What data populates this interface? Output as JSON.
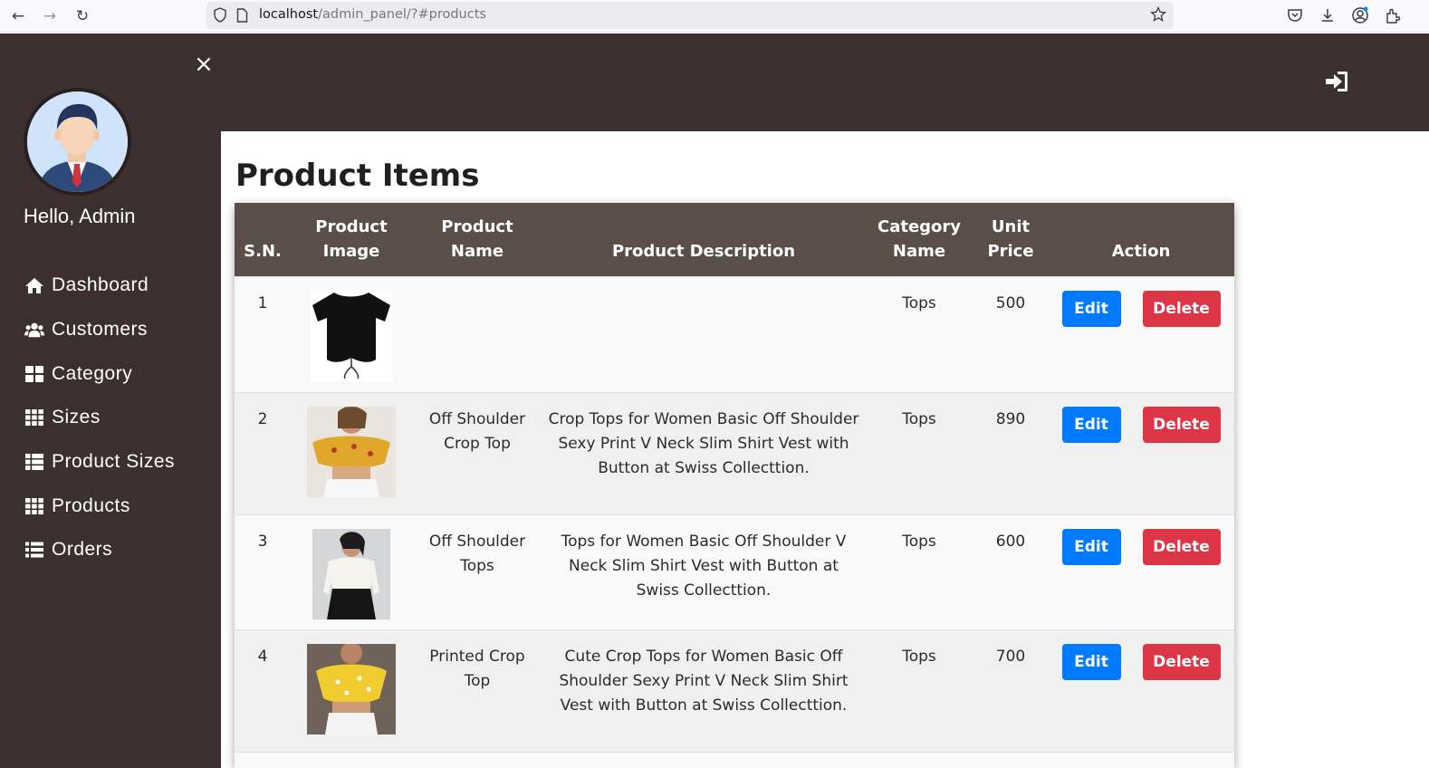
{
  "browser": {
    "url_host": "localhost",
    "url_path": "/admin_panel/?#products"
  },
  "sidebar": {
    "greeting": "Hello, Admin",
    "close_label": "×",
    "items": [
      {
        "label": "Dashboard",
        "icon": "home-icon"
      },
      {
        "label": "Customers",
        "icon": "users-icon"
      },
      {
        "label": "Category",
        "icon": "th-large-icon"
      },
      {
        "label": "Sizes",
        "icon": "th-icon"
      },
      {
        "label": "Product Sizes",
        "icon": "th-list-icon"
      },
      {
        "label": "Products",
        "icon": "th-icon"
      },
      {
        "label": "Orders",
        "icon": "list-icon"
      }
    ]
  },
  "main": {
    "title": "Product Items",
    "columns": [
      "S.N.",
      "Product Image",
      "Product Name",
      "Product Description",
      "Category Name",
      "Unit Price",
      "Action"
    ],
    "rows": [
      {
        "sn": "1",
        "image": "black-crop-top",
        "name": "",
        "description": "",
        "category": "Tops",
        "price": "500",
        "edit_label": "Edit",
        "delete_label": "Delete"
      },
      {
        "sn": "2",
        "image": "yellow-floral-off-shoulder-top",
        "name": "Off Shoulder Crop Top",
        "description": "Crop Tops for Women Basic Off Shoulder Sexy Print V Neck Slim Shirt Vest with Button at Swiss Collecttion.",
        "category": "Tops",
        "price": "890",
        "edit_label": "Edit",
        "delete_label": "Delete"
      },
      {
        "sn": "3",
        "image": "white-off-shoulder-top",
        "name": "Off Shoulder Tops",
        "description": "Tops for Women Basic Off Shoulder V Neck Slim Shirt Vest with Button at Swiss Collecttion.",
        "category": "Tops",
        "price": "600",
        "edit_label": "Edit",
        "delete_label": "Delete"
      },
      {
        "sn": "4",
        "image": "yellow-printed-crop-top",
        "name": "Printed Crop Top",
        "description": "Cute Crop Tops for Women Basic Off Shoulder Sexy Print V Neck Slim Shirt Vest with Button at Swiss Collecttion.",
        "category": "Tops",
        "price": "700",
        "edit_label": "Edit",
        "delete_label": "Delete"
      }
    ]
  },
  "colors": {
    "sidebar_bg": "#3b2f2f",
    "table_header_bg": "#5a4f48",
    "edit_button": "#007bff",
    "delete_button": "#dc3545"
  }
}
